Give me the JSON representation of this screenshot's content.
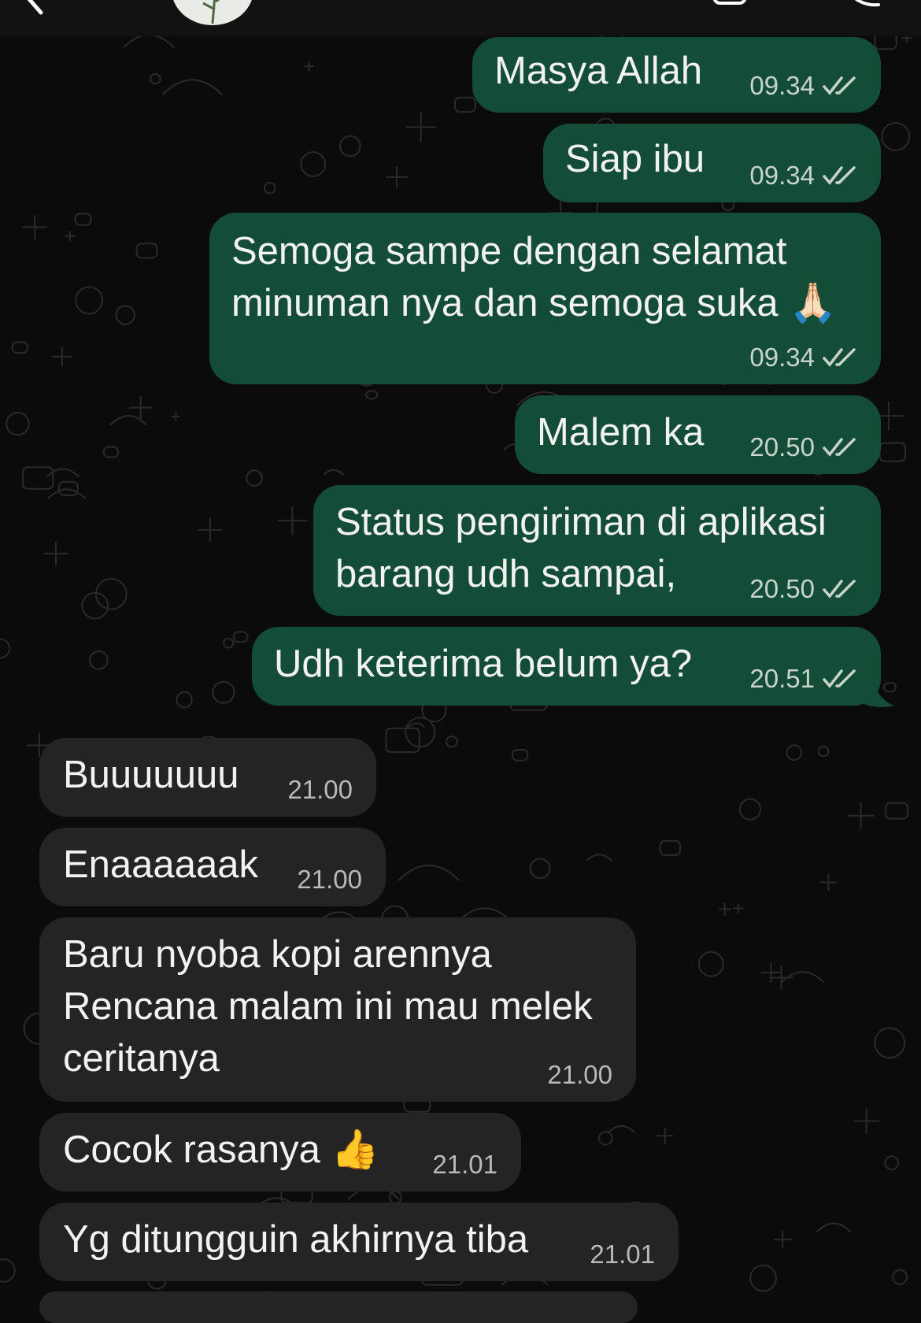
{
  "chat": {
    "outgoing": [
      {
        "text": "Masya Allah",
        "time": "09.34"
      },
      {
        "text": "Siap ibu",
        "time": "09.34"
      },
      {
        "text": "Semoga sampe dengan selamat\nminuman nya dan semoga suka 🙏🏻",
        "time": "09.34"
      },
      {
        "text": "Malem ka",
        "time": "20.50"
      },
      {
        "text": "Status pengiriman di aplikasi\nbarang udh sampai,",
        "time": "20.50"
      },
      {
        "text": "Udh keterima belum ya?",
        "time": "20.51"
      }
    ],
    "incoming": [
      {
        "text": "Buuuuuuu",
        "time": "21.00"
      },
      {
        "text": "Enaaaaaak",
        "time": "21.00"
      },
      {
        "text": "Baru nyoba kopi arennya\nRencana malam ini mau melek\nceritanya",
        "time": "21.00"
      },
      {
        "text": "Cocok rasanya 👍",
        "time": "21.01"
      },
      {
        "text": "Yg ditungguin akhirnya tiba",
        "time": "21.01"
      }
    ]
  },
  "status": {
    "read_receipt": "double-check-icon"
  },
  "colors": {
    "background": "#0b0b0b",
    "outgoing_bubble": "#144d37",
    "incoming_bubble": "#242424",
    "text": "#f2f2f2",
    "read_tick": "#c8d3cc"
  }
}
